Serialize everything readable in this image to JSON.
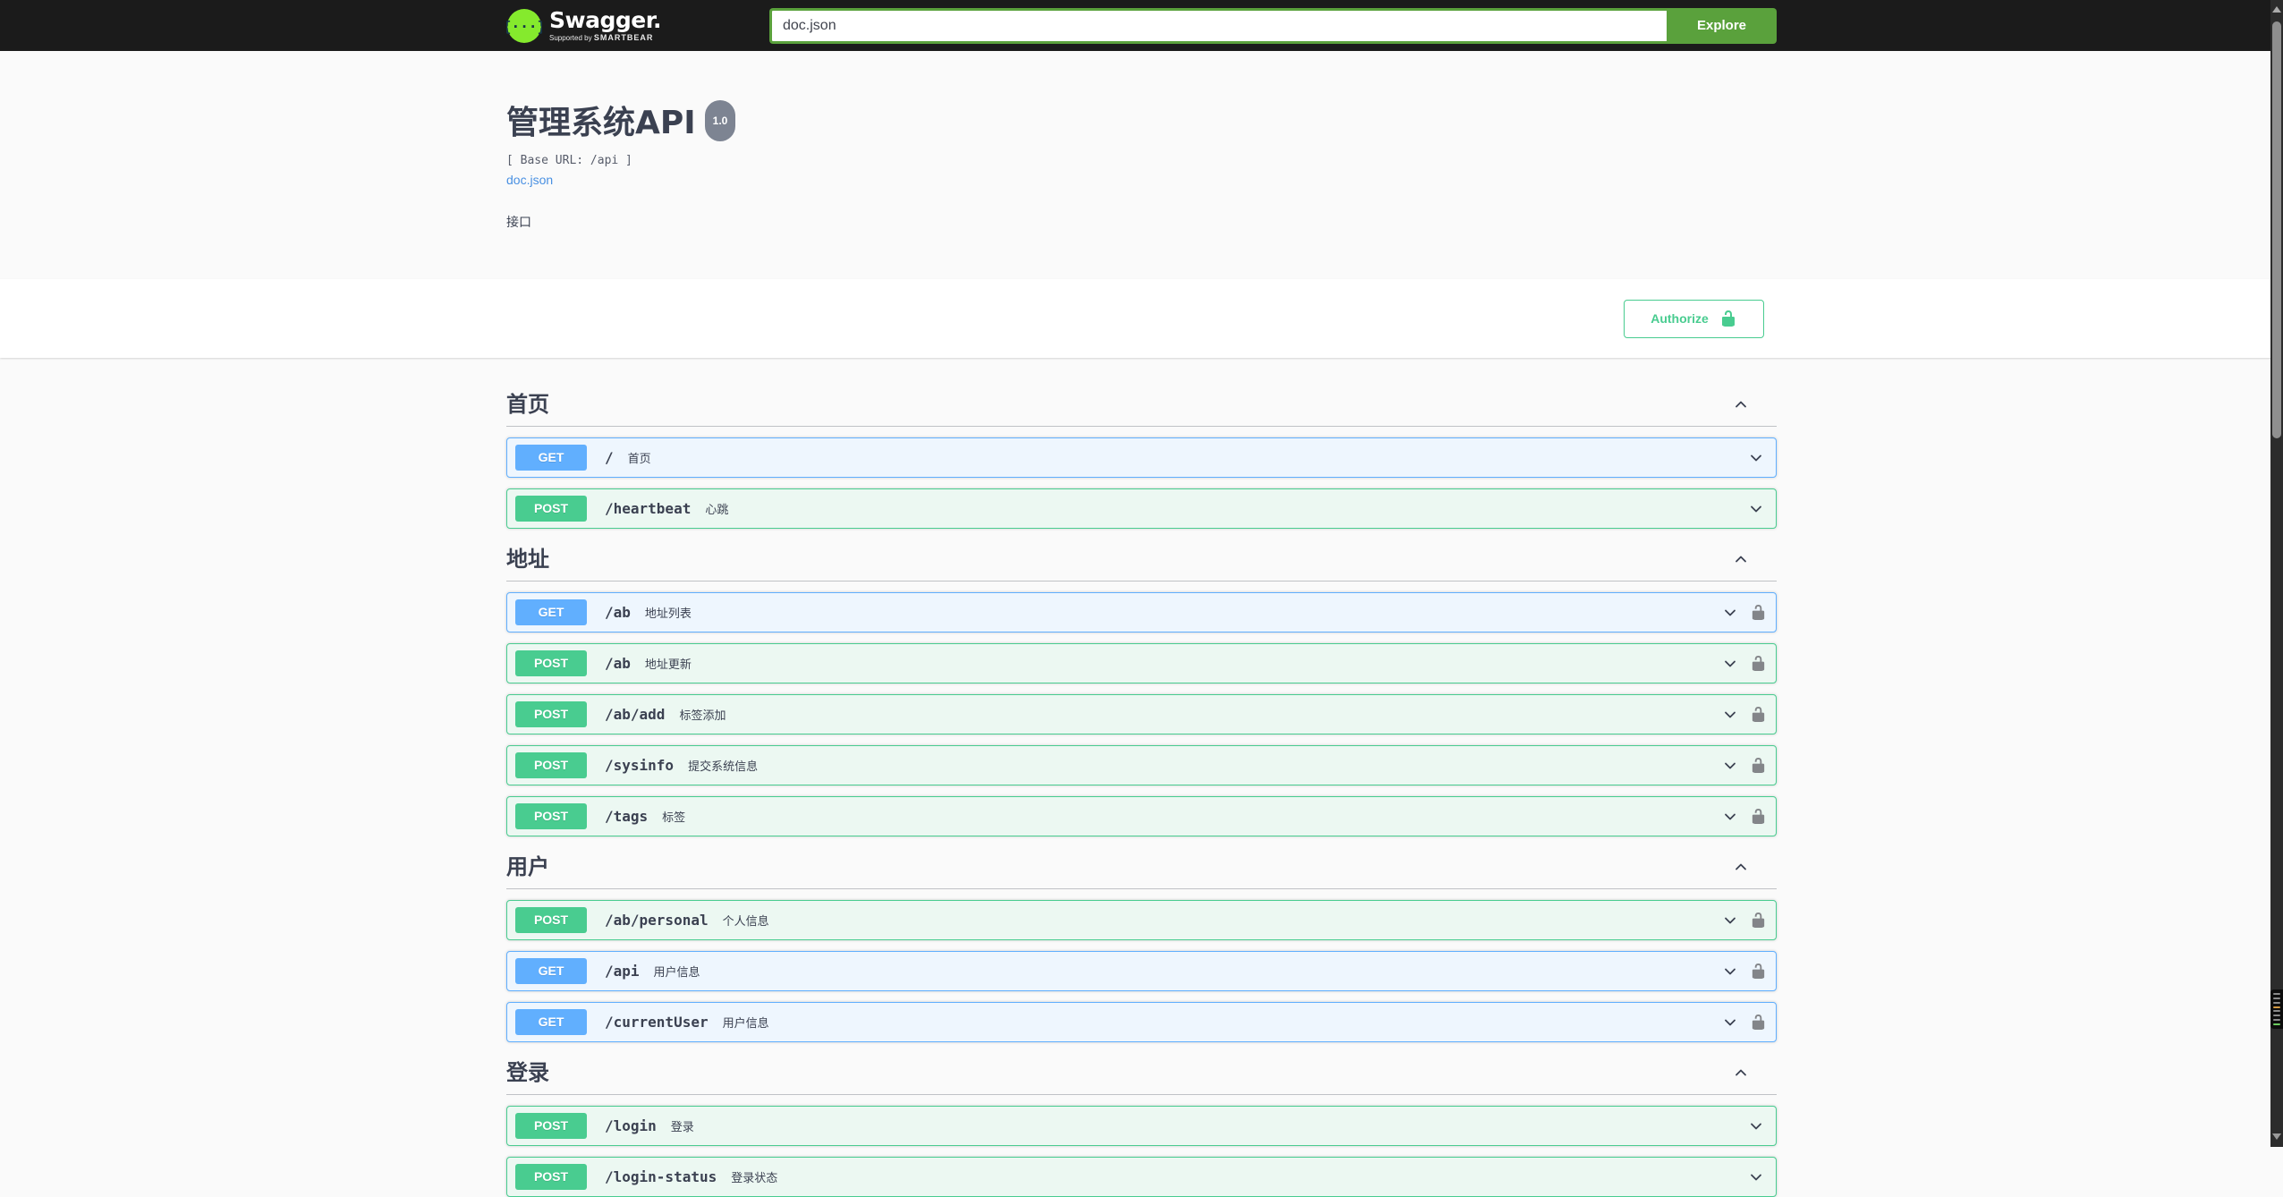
{
  "topbar": {
    "logo_text": "Swagger",
    "logo_tagline_prefix": "Supported by",
    "logo_tagline_brand": "SMARTBEAR",
    "search_value": "doc.json",
    "explore_label": "Explore"
  },
  "info": {
    "title": "管理系统API",
    "version": "1.0",
    "base_url": "[ Base URL: /api ]",
    "spec_link": "doc.json",
    "description": "接口"
  },
  "auth": {
    "authorize_label": "Authorize"
  },
  "colors": {
    "get": "#61affe",
    "post": "#49cc90",
    "topbar_bg": "#1b1b1b",
    "explore_green": "#5aa13c",
    "authorize_green": "#49cc90",
    "logo_green": "#85ea2d",
    "link_blue": "#4990e2",
    "text": "#3b4151",
    "row_lock_gray": "#838589"
  },
  "sections": [
    {
      "title": "首页",
      "expanded": true,
      "operations": [
        {
          "method": "GET",
          "path": "/",
          "summary": "首页",
          "locked": false
        },
        {
          "method": "POST",
          "path": "/heartbeat",
          "summary": "心跳",
          "locked": false
        }
      ]
    },
    {
      "title": "地址",
      "expanded": true,
      "operations": [
        {
          "method": "GET",
          "path": "/ab",
          "summary": "地址列表",
          "locked": true
        },
        {
          "method": "POST",
          "path": "/ab",
          "summary": "地址更新",
          "locked": true
        },
        {
          "method": "POST",
          "path": "/ab/add",
          "summary": "标签添加",
          "locked": true
        },
        {
          "method": "POST",
          "path": "/sysinfo",
          "summary": "提交系统信息",
          "locked": true
        },
        {
          "method": "POST",
          "path": "/tags",
          "summary": "标签",
          "locked": true
        }
      ]
    },
    {
      "title": "用户",
      "expanded": true,
      "operations": [
        {
          "method": "POST",
          "path": "/ab/personal",
          "summary": "个人信息",
          "locked": true
        },
        {
          "method": "GET",
          "path": "/api",
          "summary": "用户信息",
          "locked": true
        },
        {
          "method": "GET",
          "path": "/currentUser",
          "summary": "用户信息",
          "locked": true
        }
      ]
    },
    {
      "title": "登录",
      "expanded": true,
      "operations": [
        {
          "method": "POST",
          "path": "/login",
          "summary": "登录",
          "locked": false
        },
        {
          "method": "POST",
          "path": "/login-status",
          "summary": "登录状态",
          "locked": false
        }
      ]
    }
  ],
  "scrollbar": {
    "annotation_colors": [
      "#8a8a8a",
      "#8a8a8a",
      "#8a8a8a",
      "#d49a43",
      "#8a8a8a",
      "#8a8a8a",
      "#8a8a8a",
      "#6ccc5f"
    ]
  }
}
